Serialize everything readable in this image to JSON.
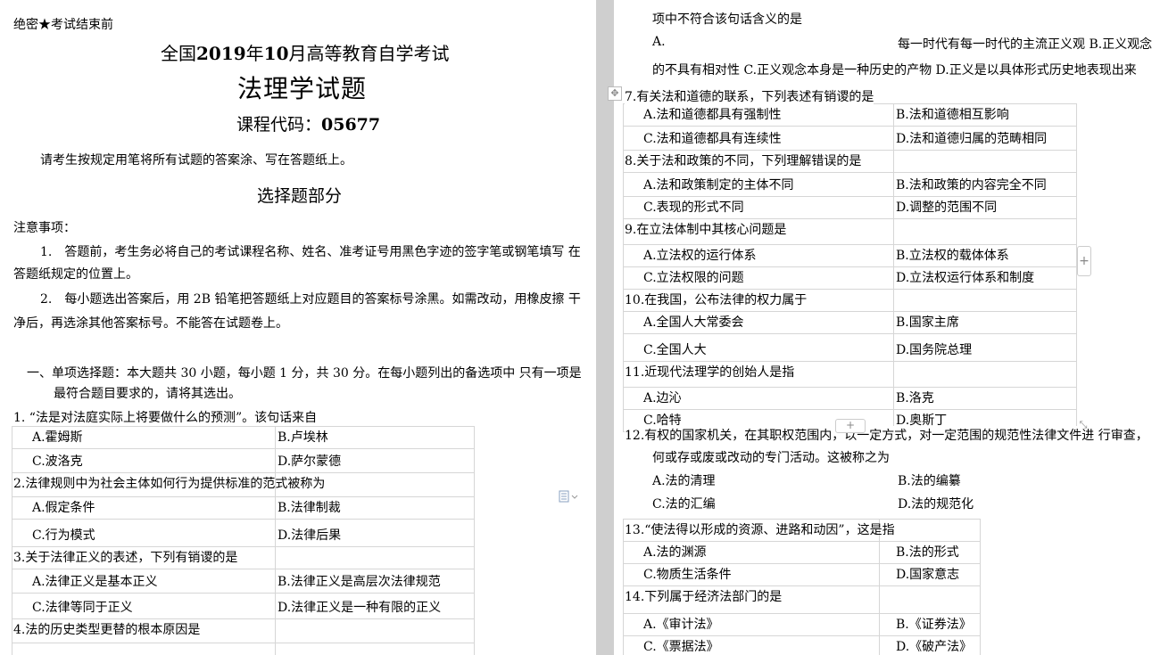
{
  "header": {
    "secret": "绝密★考试结束前",
    "exam_pre": "全国",
    "exam_year": "2019",
    "exam_mid": "年",
    "exam_month": "10",
    "exam_post": "月高等教育自学考试",
    "subject": "法理学试题",
    "course_code_label": "课程代码：",
    "course_code": "05677",
    "instruction": "请考生按规定用笔将所有试题的答案涂、写在答题纸上。"
  },
  "section_title": "选择题部分",
  "notes": {
    "title": "注意事项：",
    "n1_line1": "1.　答题前，考生务必将自己的考试课程名称、姓名、准考证号用黑色字迹的签字笔或钢笔填写 在",
    "n1_line2": "答题纸规定的位置上。",
    "n2_line1": "2.　每小题选出答案后，用 2B 铅笔把答题纸上对应题目的答案标号涂黑。如需改动，用橡皮擦 干",
    "n2_line2": "净后，再选涂其他答案标号。不能答在试题卷上。"
  },
  "part_one": {
    "line1": "一、单项选择题：本大题共 30 小题，每小题 1 分，共 30 分。在每小题列出的备选项中 只有一项是",
    "line2": "最符合题目要求的，请将其选出。"
  },
  "q1": {
    "stem": "1. “法是对法庭实际上将要做什么的预测”。该句话来自",
    "a": "A.霍姆斯",
    "b": "B.卢埃林",
    "c": "C.波洛克",
    "d": "D.萨尔蒙德"
  },
  "q2": {
    "stem": "2.法律规则中为社会主体如何行为提供标准的范式被称为",
    "a": "A.假定条件",
    "b": "B.法律制裁",
    "c": "C.行为模式",
    "d": "D.法律后果"
  },
  "q3": {
    "stem": "3.关于法律正义的表述，下列有销谡的是",
    "a": "A.法律正义是基本正义",
    "b": "B.法律正义是高层次法律规范",
    "c": "C.法律等同于正义",
    "d": "D.法律正义是一种有限的正义"
  },
  "q4": {
    "stem": "4.法的历史类型更替的根本原因是"
  },
  "q6cont": {
    "line1": "项中不符合该句话含义的是",
    "opt_a": "A.",
    "line2_tail": "每一时代有每一时代的主流正义观 B.正义观念",
    "line3": "的不具有相对性 C.正义观念本身是一种历史的产物 D.正义是以具体形式历史地表现出来"
  },
  "q7": {
    "stem": "7.有关法和道德的联系，下列表述有销谡的是",
    "a": "A.法和道德都具有强制性",
    "b": "B.法和道德相互影响",
    "c": "C.法和道德都具有连续性",
    "d": "D.法和道德归属的范畴相同"
  },
  "q8": {
    "stem": "8.关于法和政策的不同，下列理解错误的是",
    "a": "A.法和政策制定的主体不同",
    "b": "B.法和政策的内容完全不同",
    "c": "C.表现的形式不同",
    "d": "D.调整的范围不同"
  },
  "q9": {
    "stem": "9.在立法体制中其核心问题是",
    "a": "A.立法权的运行体系",
    "b": "B.立法权的载体体系",
    "c": "C.立法权限的问题",
    "d": "D.立法权运行体系和制度"
  },
  "q10": {
    "stem": "10.在我国，公布法律的权力属于",
    "a": "A.全国人大常委会",
    "b": "B.国家主席",
    "c": "C.全国人大",
    "d": "D.国务院总理"
  },
  "q11": {
    "stem": "11.近现代法理学的创始人是指",
    "a": "A.边沁",
    "b": "B.洛克",
    "c": "C.哈特",
    "d": "D.奥斯丁"
  },
  "q12": {
    "line1": "12.有权的国家机关，在其职权范围内，以一定方式，对一定范围的规范性法律文件进 行审查，",
    "line2": "何或存或废或改动的专门活动。这被称之为",
    "a": "A.法的清理",
    "b": "B.法的编纂",
    "c": "C.法的汇编",
    "d": "D.法的规范化"
  },
  "q13": {
    "stem": "13.“使法得以形成的资源、进路和动因”，这是指",
    "a": "A.法的渊源",
    "b": "B.法的形式",
    "c": "C.物质生活条件",
    "d": "D.国家意志"
  },
  "q14": {
    "stem": "14.下列属于经济法部门的是",
    "a": "A.《审计法》",
    "b": "B.《证券法》",
    "c": "C.《票据法》",
    "d": "D.《破产法》"
  },
  "icons": {
    "move": "move-handle-icon",
    "add": "plus-icon",
    "resize": "resize-icon",
    "doc": "document-icon"
  }
}
